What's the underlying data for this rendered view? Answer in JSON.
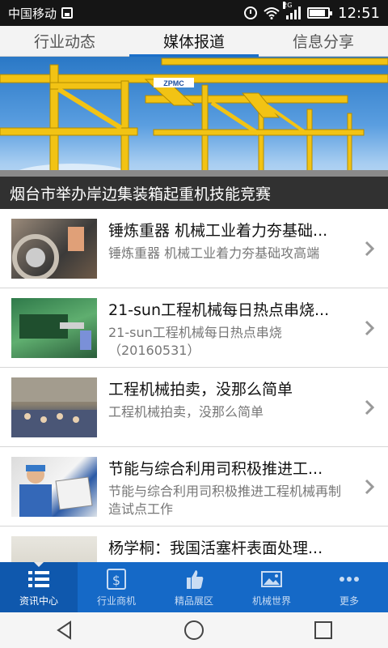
{
  "status_bar": {
    "carrier": "中国移动",
    "network_tag": "2G",
    "time": "12:51"
  },
  "tabs": [
    {
      "label": "行业动态",
      "active": false
    },
    {
      "label": "媒体报道",
      "active": true
    },
    {
      "label": "信息分享",
      "active": false
    }
  ],
  "banner": {
    "caption": "烟台市举办岸边集装箱起重机技能竞赛",
    "crane_text": "ZPMC"
  },
  "news": [
    {
      "title": "锤炼重器 机械工业着力夯基础...",
      "desc": "锤炼重器 机械工业着力夯基础攻高端"
    },
    {
      "title": "21-sun工程机械每日热点串烧...",
      "desc": "21-sun工程机械每日热点串烧（20160531）"
    },
    {
      "title": "工程机械拍卖，没那么简单",
      "desc": "工程机械拍卖，没那么简单"
    },
    {
      "title": "节能与综合利用司积极推进工...",
      "desc": "节能与综合利用司积极推进工程机械再制造试点工作"
    },
    {
      "title": "杨学桐：我国活塞杆表面处理...",
      "desc": ""
    }
  ],
  "bottom_nav": [
    {
      "label": "资讯中心",
      "icon": "list-icon",
      "active": true
    },
    {
      "label": "行业商机",
      "icon": "dollar-icon",
      "active": false
    },
    {
      "label": "精品展区",
      "icon": "thumbs-up-icon",
      "active": false
    },
    {
      "label": "机械世界",
      "icon": "picture-icon",
      "active": false
    },
    {
      "label": "更多",
      "icon": "more-icon",
      "active": false
    }
  ],
  "colors": {
    "accent": "#1569c7",
    "tab_indicator": "#1b6fc8",
    "crane_yellow": "#f2c314"
  }
}
